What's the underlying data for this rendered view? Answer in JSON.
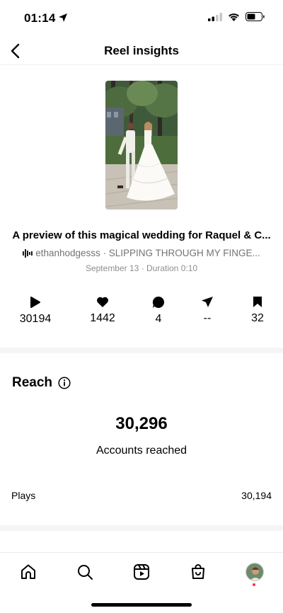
{
  "status_bar": {
    "time": "01:14"
  },
  "nav": {
    "title": "Reel insights"
  },
  "reel": {
    "title": "A preview of this magical wedding for Raquel & C...",
    "audio": "ethanhodgesss · SLIPPING THROUGH MY FINGE...",
    "meta": "September 13 · Duration 0:10"
  },
  "stats": {
    "plays": "30194",
    "likes": "1442",
    "comments": "4",
    "shares": "--",
    "saves": "32"
  },
  "reach": {
    "title": "Reach",
    "value": "30,296",
    "label": "Accounts reached"
  },
  "plays_row": {
    "label": "Plays",
    "value": "30,194"
  },
  "icons": [
    "back-icon",
    "play-icon",
    "heart-icon",
    "comment-icon",
    "send-icon",
    "bookmark-icon",
    "info-icon",
    "home-icon",
    "search-icon",
    "reels-icon",
    "shop-icon"
  ],
  "colors": {
    "text": "#000000",
    "muted": "#737373",
    "notification": "#ff3040"
  }
}
